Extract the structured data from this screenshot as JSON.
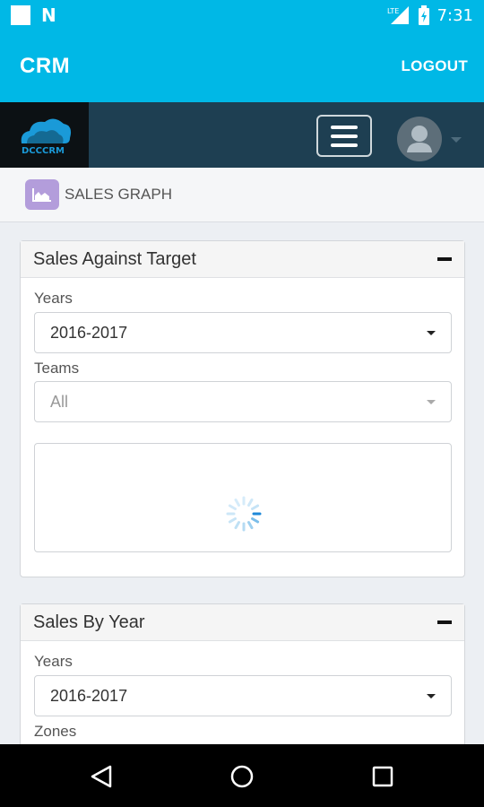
{
  "status_bar": {
    "time": "7:31",
    "network": "LTE"
  },
  "app_bar": {
    "title": "CRM",
    "logout_label": "LOGOUT"
  },
  "nav": {
    "logo_text": "DCCCRM"
  },
  "breadcrumb": {
    "label": "SALES GRAPH"
  },
  "panels": [
    {
      "title": "Sales Against Target",
      "fields": [
        {
          "label": "Years",
          "value": "2016-2017"
        },
        {
          "label": "Teams",
          "value": "All"
        }
      ]
    },
    {
      "title": "Sales By Year",
      "fields": [
        {
          "label": "Years",
          "value": "2016-2017"
        },
        {
          "label": "Zones",
          "value": ""
        }
      ]
    }
  ]
}
